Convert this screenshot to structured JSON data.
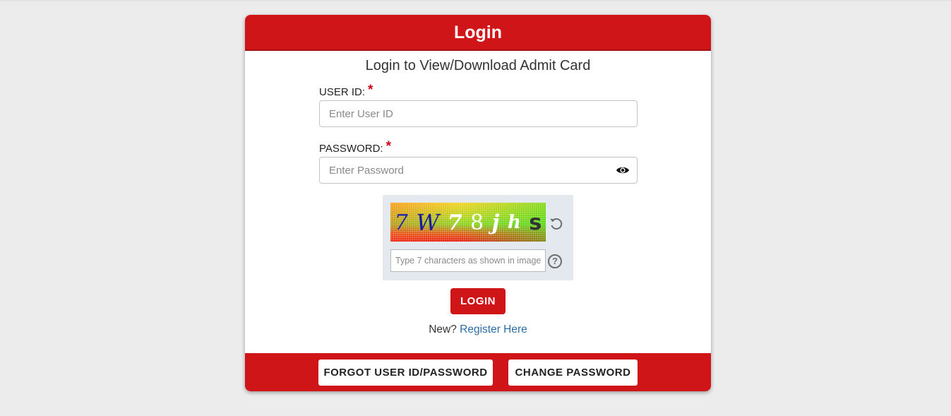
{
  "login_card": {
    "header_title": "Login",
    "subtitle": "Login to View/Download Admit Card",
    "user_id": {
      "label": "USER ID:",
      "required_mark": "*",
      "placeholder": "Enter User ID",
      "value": ""
    },
    "password": {
      "label": "PASSWORD:",
      "required_mark": "*",
      "placeholder": "Enter Password",
      "value": "",
      "toggle_icon": "eye-icon"
    },
    "captcha": {
      "characters": [
        "7",
        "W",
        "7",
        "8",
        "j",
        "h",
        "s"
      ],
      "character_colors": [
        "#1a2aa8",
        "#1a1aa0",
        "#ffffff",
        "#ffffff",
        "#ffffff",
        "#ffffff",
        "#333333"
      ],
      "input_placeholder": "Type 7 characters as shown in image",
      "input_value": "",
      "refresh_icon": "refresh-icon",
      "help_icon": "help-icon",
      "help_glyph": "?"
    },
    "login_button_label": "LOGIN",
    "register": {
      "prompt": "New?",
      "link_text": "Register Here"
    },
    "footer": {
      "forgot_label": "FORGOT USER ID/PASSWORD",
      "change_password_label": "CHANGE PASSWORD"
    }
  },
  "colors": {
    "brand_red": "#cf1518",
    "link_blue": "#2e6da4",
    "page_background": "#ececec",
    "captcha_panel": "#e3e9ee"
  }
}
